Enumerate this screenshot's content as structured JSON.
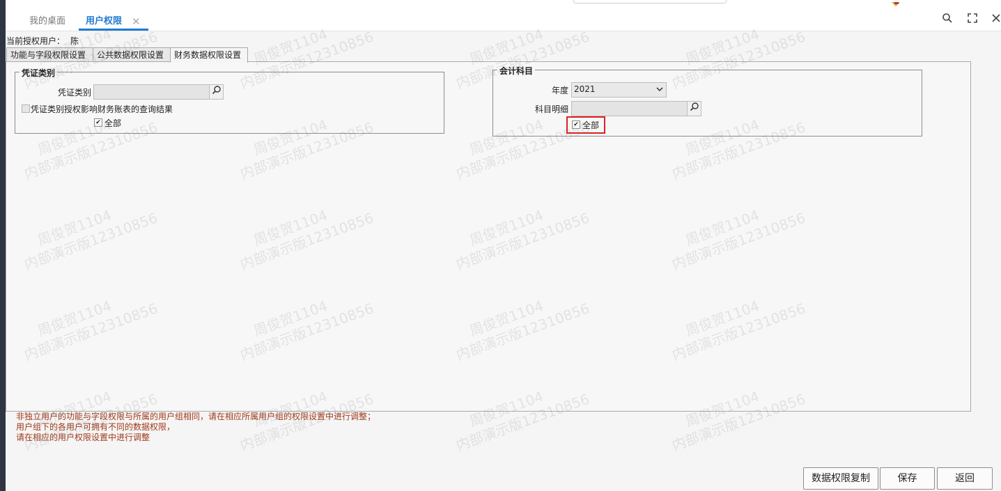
{
  "tabs": {
    "home": "我的桌面",
    "active": "用户权限",
    "close_glyph": "✕"
  },
  "toolbar_icons": [
    "search-icon",
    "fullscreen-icon",
    "close-icon"
  ],
  "current_user": {
    "label": "当前授权用户：",
    "value": "陈"
  },
  "subtabs": [
    "功能与字段权限设置",
    "公共数据权限设置",
    "财务数据权限设置"
  ],
  "voucher_group": {
    "legend": "凭证类别",
    "field_label": "凭证类别",
    "field_value": "",
    "affect_checkbox_label": "凭证类别授权影响财务账表的查询结果",
    "affect_checked": false,
    "all_label": "全部",
    "all_checked": true
  },
  "account_group": {
    "legend": "会计科目",
    "year_label": "年度",
    "year_value": "2021",
    "detail_label": "科目明细",
    "detail_value": "",
    "all_label": "全部",
    "all_checked": true
  },
  "notes": [
    "非独立用户的功能与字段权限与所属的用户组相同，请在相应所属用户组的权限设置中进行调整；",
    "用户组下的各用户可拥有不同的数据权限，",
    "请在相应的用户权限设置中进行调整"
  ],
  "buttons": {
    "copy": "数据权限复制",
    "save": "保存",
    "back": "返回"
  },
  "watermark": {
    "line1": "周俊贺1104",
    "line2": "内部演示版12310856"
  },
  "colors": {
    "accent": "#1f7ad1",
    "highlight": "#e02020",
    "note": "#a0391a"
  }
}
